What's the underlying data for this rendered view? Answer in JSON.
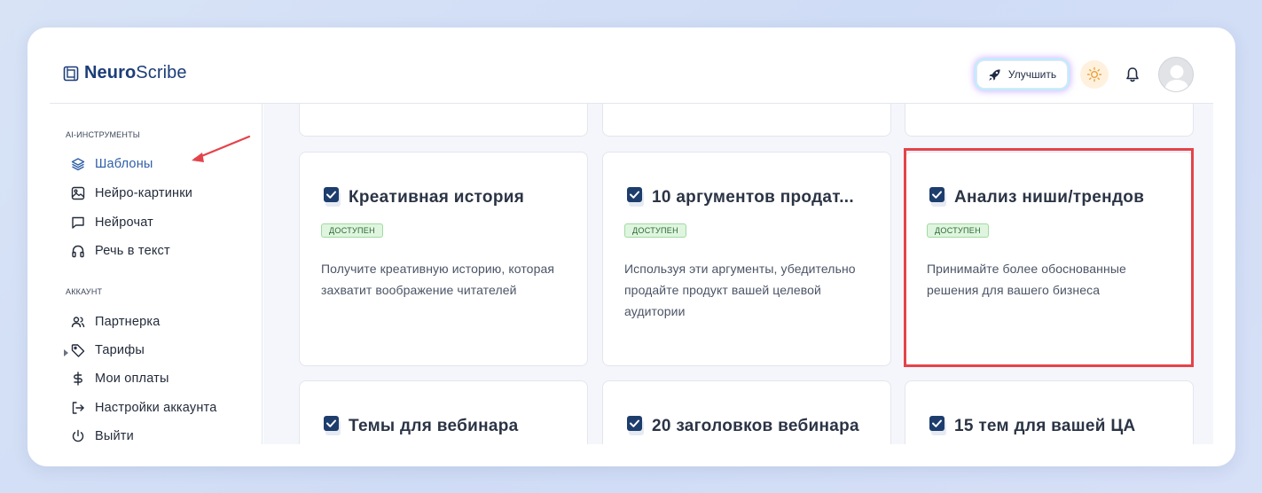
{
  "header": {
    "logo_bold": "Neuro",
    "logo_rest": "Scribe",
    "upgrade_label": "Улучшить",
    "icons": [
      "rocket-icon",
      "sun-icon",
      "bell-icon",
      "avatar"
    ]
  },
  "sidebar": {
    "sections": [
      {
        "label": "AI-ИНСТРУМЕНТЫ",
        "items": [
          {
            "label": "Шаблоны",
            "icon": "layers-icon",
            "active": true
          },
          {
            "label": "Нейро-картинки",
            "icon": "image-icon"
          },
          {
            "label": "Нейрочат",
            "icon": "chat-icon"
          },
          {
            "label": "Речь в текст",
            "icon": "headphones-icon"
          }
        ]
      },
      {
        "label": "АККАУНТ",
        "items": [
          {
            "label": "Партнерка",
            "icon": "users-icon",
            "expandable": true
          },
          {
            "label": "Тарифы",
            "icon": "tag-icon"
          },
          {
            "label": "Мои оплаты",
            "icon": "dollar-icon"
          },
          {
            "label": "Настройки аккаунта",
            "icon": "login-icon"
          },
          {
            "label": "Выйти",
            "icon": "power-icon"
          }
        ]
      }
    ]
  },
  "templates": [
    {
      "title": "Креативная история",
      "status": "ДОСТУПЕН",
      "description": "Получите креативную историю, которая захватит воображение читателей"
    },
    {
      "title": "10 аргументов продат...",
      "status": "ДОСТУПЕН",
      "description": "Используя эти аргументы, убедительно продайте продукт вашей целевой аудитории"
    },
    {
      "title": "Анализ ниши/трендов",
      "status": "ДОСТУПЕН",
      "description": "Принимайте более обоснованные решения для вашего бизнеса",
      "highlighted": true
    },
    {
      "title": "Темы для вебинара"
    },
    {
      "title": "20 заголовков вебинара"
    },
    {
      "title": "15 тем для вашей ЦА"
    }
  ],
  "colors": {
    "accent": "#2f5fa8",
    "badge_bg": "#dff5df",
    "highlight": "#e5434a",
    "annotation_arrow": "#e5434a"
  }
}
